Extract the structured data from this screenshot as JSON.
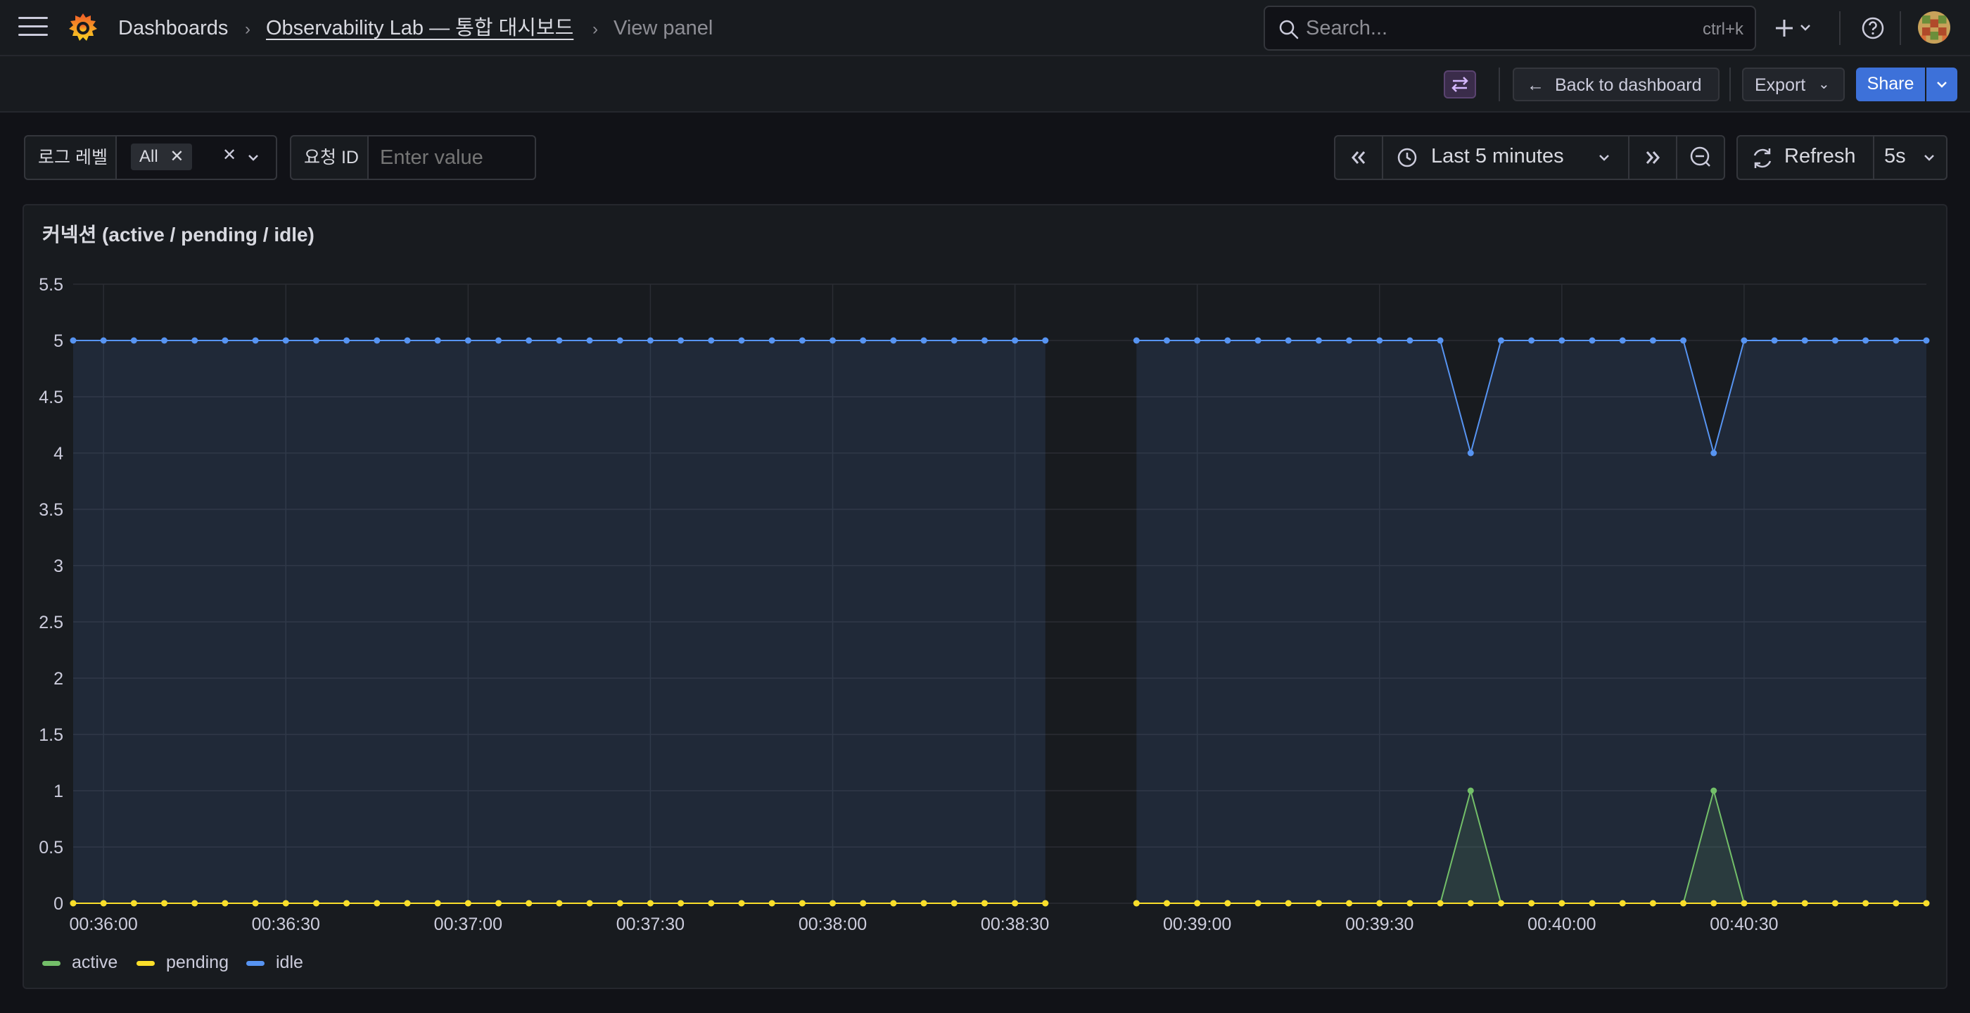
{
  "topbar": {
    "breadcrumb_dashboards": "Dashboards",
    "breadcrumb_dashboard": "Observability Lab — 통합 대시보드",
    "breadcrumb_current": "View panel",
    "breadcrumb_separator": "›",
    "search_placeholder": "Search...",
    "search_shortcut": "ctrl+k"
  },
  "toolbar": {
    "back_label": "Back to dashboard",
    "export_label": "Export",
    "share_label": "Share"
  },
  "variables": [
    {
      "label": "로그 레벨",
      "chip": "All"
    },
    {
      "label": "요청 ID",
      "placeholder": "Enter value"
    }
  ],
  "time_controls": {
    "range_label": "Last 5 minutes",
    "refresh_label": "Refresh",
    "interval": "5s"
  },
  "panel": {
    "title": "커넥션 (active / pending / idle)"
  },
  "colors": {
    "active": "#73bf69",
    "pending": "#fade2a",
    "idle": "#5794f2",
    "primary": "#3d71d9"
  },
  "chart_data": {
    "type": "line",
    "x_unit": "time",
    "x_start": "00:35:55",
    "x_step_seconds": 5,
    "x_ticks": [
      "00:36:00",
      "00:36:30",
      "00:37:00",
      "00:37:30",
      "00:38:00",
      "00:38:30",
      "00:39:00",
      "00:39:30",
      "00:40:00",
      "00:40:30"
    ],
    "ylim": [
      0,
      5.5
    ],
    "y_ticks": [
      0,
      0.5,
      1,
      1.5,
      2,
      2.5,
      3,
      3.5,
      4,
      4.5,
      5,
      5.5
    ],
    "legend_position": "bottom-left",
    "grid": true,
    "series": [
      {
        "name": "active",
        "values": [
          0,
          0,
          0,
          0,
          0,
          0,
          0,
          0,
          0,
          0,
          0,
          0,
          0,
          0,
          0,
          0,
          0,
          0,
          0,
          0,
          0,
          0,
          0,
          0,
          0,
          0,
          0,
          0,
          0,
          0,
          0,
          0,
          0,
          null,
          null,
          0,
          0,
          0,
          0,
          0,
          0,
          0,
          0,
          0,
          0,
          0,
          1,
          0,
          0,
          0,
          0,
          0,
          0,
          0,
          1,
          0,
          0,
          0,
          0,
          0,
          0,
          0
        ]
      },
      {
        "name": "pending",
        "values": [
          0,
          0,
          0,
          0,
          0,
          0,
          0,
          0,
          0,
          0,
          0,
          0,
          0,
          0,
          0,
          0,
          0,
          0,
          0,
          0,
          0,
          0,
          0,
          0,
          0,
          0,
          0,
          0,
          0,
          0,
          0,
          0,
          0,
          null,
          null,
          0,
          0,
          0,
          0,
          0,
          0,
          0,
          0,
          0,
          0,
          0,
          0,
          0,
          0,
          0,
          0,
          0,
          0,
          0,
          0,
          0,
          0,
          0,
          0,
          0,
          0,
          0
        ]
      },
      {
        "name": "idle",
        "values": [
          5,
          5,
          5,
          5,
          5,
          5,
          5,
          5,
          5,
          5,
          5,
          5,
          5,
          5,
          5,
          5,
          5,
          5,
          5,
          5,
          5,
          5,
          5,
          5,
          5,
          5,
          5,
          5,
          5,
          5,
          5,
          5,
          5,
          null,
          null,
          5,
          5,
          5,
          5,
          5,
          5,
          5,
          5,
          5,
          5,
          5,
          4,
          5,
          5,
          5,
          5,
          5,
          5,
          5,
          4,
          5,
          5,
          5,
          5,
          5,
          5,
          5
        ]
      }
    ]
  }
}
